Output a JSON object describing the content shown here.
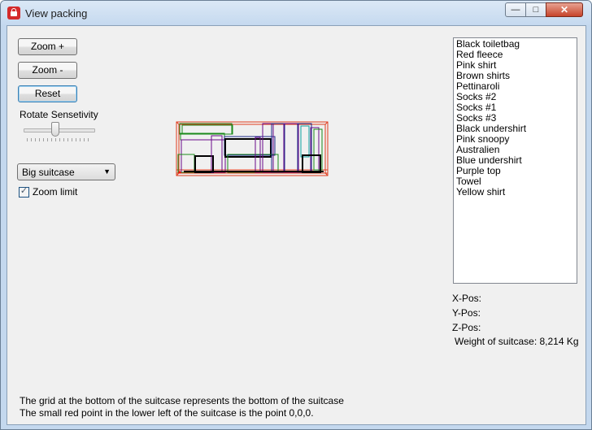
{
  "window": {
    "title": "View packing",
    "buttons": {
      "minimize": "—",
      "maximize": "□",
      "close": "✕"
    }
  },
  "controls": {
    "zoom_in_label": "Zoom +",
    "zoom_out_label": "Zoom -",
    "reset_label": "Reset",
    "rotate_label": "Rotate Sensetivity",
    "rotate_level": 0.45,
    "suitcase_select": {
      "selected": "Big suitcase"
    },
    "zoom_limit_label": "Zoom limit",
    "zoom_limit_checked": true
  },
  "items": [
    "Black toiletbag",
    "Red fleece",
    "Pink shirt",
    "Brown shirts",
    "Pettinaroli",
    "Socks #2",
    "Socks #1",
    "Socks #3",
    "Black undershirt",
    "Pink snoopy",
    "Australien",
    "Blue undershirt",
    "Purple top",
    "Towel",
    "Yellow shirt"
  ],
  "position": {
    "x_label": "X-Pos:",
    "y_label": "Y-Pos:",
    "z_label": "Z-Pos:",
    "weight": "Weight of suitcase: 8,214 Kg"
  },
  "info": {
    "line1": "The grid at the bottom of the suitcase represents the bottom of the suitcase",
    "line2": "The small red point in the lower left of the suitcase is the point 0,0,0."
  },
  "colors": {
    "suitcase_outline": "#e03c1e",
    "box_colors": [
      "#1a8a1a",
      "#6a0a8a",
      "#1e2a8a",
      "#000000",
      "#0aa0a0"
    ]
  }
}
